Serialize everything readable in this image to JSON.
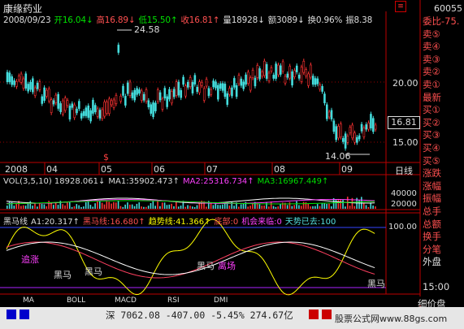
{
  "header": {
    "stock_name": "康缘药业",
    "info": [
      {
        "text": "2008/09/23",
        "color": "wht"
      },
      {
        "text": "开16.04↓",
        "color": "grn"
      },
      {
        "text": "高16.89↓",
        "color": "red"
      },
      {
        "text": "低15.50↑",
        "color": "grn"
      },
      {
        "text": "收16.81↑",
        "color": "red"
      },
      {
        "text": "量18928↓",
        "color": "wht"
      },
      {
        "text": "额3089↓",
        "color": "wht"
      },
      {
        "text": "换0.96%",
        "color": "wht"
      },
      {
        "text": "振8.38",
        "color": "wht"
      }
    ],
    "window_button": "≡"
  },
  "price_chart": {
    "max_label": "24.58",
    "min_label": "14.06",
    "current_price": "16.81",
    "y_ticks": [
      "20.00",
      "15.00"
    ],
    "x_ticks": [
      "2008",
      "04",
      "05",
      "06",
      "07",
      "08",
      "09"
    ],
    "period_label": "日线"
  },
  "volume": {
    "legend": [
      {
        "text": "VOL(3,5,10) 18928.061↓",
        "color": "wht"
      },
      {
        "text": "MA1:35902.473↑",
        "color": "wht"
      },
      {
        "text": "MA2:25316.734↑",
        "color": "mag"
      },
      {
        "text": "MA3:16967.449↑",
        "color": "grn"
      }
    ],
    "y_ticks": [
      "40000",
      "20000"
    ]
  },
  "indicator": {
    "legend": [
      {
        "text": "黑马线",
        "color": "wht"
      },
      {
        "text": "A1:20.317↑",
        "color": "wht"
      },
      {
        "text": "黑马线:16.680↑",
        "color": "red"
      },
      {
        "text": "趋势线:41.366↑",
        "color": "yel"
      },
      {
        "text": "底部:0",
        "color": "red"
      },
      {
        "text": "机会来临:0",
        "color": "mag"
      },
      {
        "text": "天势已去:100",
        "color": "cyan"
      }
    ],
    "y_top": "100.00",
    "labels": [
      "追涨",
      "黑马",
      "黑马",
      "黑马",
      "离场",
      "黑马"
    ]
  },
  "tabs": [
    "MA",
    "BOLL",
    "MACD",
    "RSI",
    "DMI"
  ],
  "right_panel": {
    "code": "60055",
    "rows": [
      {
        "text": "委比-75.",
        "color": "red"
      },
      {
        "text": "卖⑤",
        "color": "red"
      },
      {
        "text": "卖④",
        "color": "red"
      },
      {
        "text": "卖③",
        "color": "red"
      },
      {
        "text": "卖②",
        "color": "red"
      },
      {
        "text": "卖①",
        "color": "red"
      },
      {
        "text": "最新",
        "color": "red"
      },
      {
        "text": "买①",
        "color": "red"
      },
      {
        "text": "买②",
        "color": "red"
      },
      {
        "text": "买③",
        "color": "red"
      },
      {
        "text": "买④",
        "color": "red"
      },
      {
        "text": "买⑤",
        "color": "red"
      },
      {
        "text": "涨跌",
        "color": "red"
      },
      {
        "text": "涨幅",
        "color": "red"
      },
      {
        "text": "振幅",
        "color": "red"
      },
      {
        "text": "总手",
        "color": "red"
      },
      {
        "text": "总额",
        "color": "red"
      },
      {
        "text": "换手",
        "color": "red"
      },
      {
        "text": "分笔",
        "color": "red"
      },
      {
        "text": "外盘",
        "color": "wht"
      },
      {
        "text": "",
        "color": "wht"
      },
      {
        "text": "15:00",
        "color": "wht"
      }
    ],
    "bottom_label": "细价盘"
  },
  "status": {
    "index_text": "深 7062.08 -407.00 -5.45% 274.67亿",
    "ad_text": "股票公式网www.88gs.com"
  }
}
